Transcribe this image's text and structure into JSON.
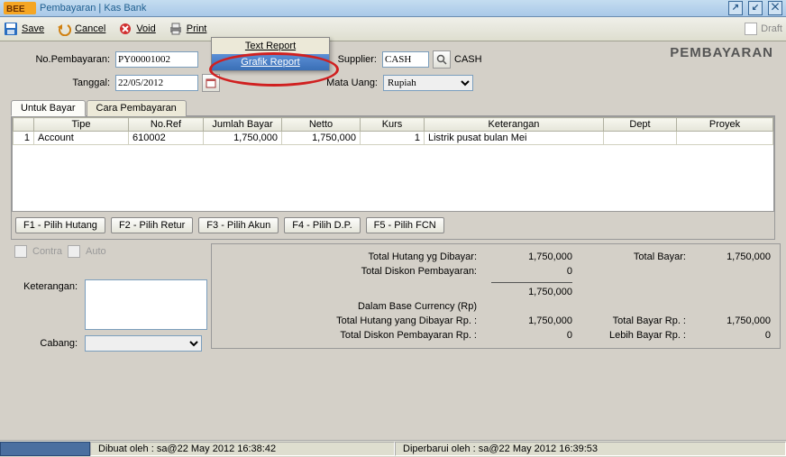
{
  "window": {
    "title": "Pembayaran | Kas Bank"
  },
  "toolbar": {
    "save": "Save",
    "cancel": "Cancel",
    "void": "Void",
    "print": "Print",
    "draft": "Draft"
  },
  "popup": {
    "text_report": "Text Report",
    "grafik_report": "Grafik Report"
  },
  "page": {
    "title": "PEMBAYARAN"
  },
  "form": {
    "labels": {
      "no_pembayaran": "No.Pembayaran:",
      "tanggal": "Tanggal:",
      "supplier": "Supplier:",
      "mata_uang": "Mata Uang:"
    },
    "no_pembayaran": "PY00001002",
    "tanggal": "22/05/2012",
    "supplier_code": "CASH",
    "supplier_name": "CASH",
    "mata_uang": "Rupiah"
  },
  "tabs": {
    "untuk_bayar": "Untuk Bayar",
    "cara_pembayaran": "Cara Pembayaran"
  },
  "grid": {
    "headers": {
      "row": "",
      "tipe": "Tipe",
      "noref": "No.Ref",
      "jumlah_bayar": "Jumlah Bayar",
      "netto": "Netto",
      "kurs": "Kurs",
      "keterangan": "Keterangan",
      "dept": "Dept",
      "proyek": "Proyek"
    },
    "rows": [
      {
        "n": "1",
        "tipe": "Account",
        "noref": "610002",
        "jumlah_bayar": "1,750,000",
        "netto": "1,750,000",
        "kurs": "1",
        "keterangan": "Listrik pusat bulan Mei",
        "dept": "",
        "proyek": ""
      }
    ]
  },
  "buttons": {
    "f1": "F1 - Pilih Hutang",
    "f2": "F2 - Pilih Retur",
    "f3": "F3 - Pilih Akun",
    "f4": "F4 - Pilih D.P.",
    "f5": "F5 - Pilih FCN"
  },
  "checks": {
    "contra": "Contra",
    "auto": "Auto"
  },
  "totals": {
    "labels": {
      "total_hutang_dibayar": "Total Hutang yg Dibayar:",
      "total_diskon_pembayaran": "Total Diskon Pembayaran:",
      "base_currency": "Dalam Base Currency (Rp)",
      "total_hutang_rp": "Total Hutang yang Dibayar Rp. :",
      "total_diskon_rp": "Total Diskon Pembayaran Rp. :",
      "total_bayar": "Total Bayar:",
      "total_bayar_rp": "Total Bayar Rp. :",
      "lebih_bayar_rp": "Lebih Bayar Rp. :"
    },
    "total_hutang_dibayar": "1,750,000",
    "total_diskon_pembayaran": "0",
    "subtotal": "1,750,000",
    "total_hutang_rp": "1,750,000",
    "total_diskon_rp": "0",
    "total_bayar": "1,750,000",
    "total_bayar_rp": "1,750,000",
    "lebih_bayar_rp": "0"
  },
  "lower": {
    "keterangan_label": "Keterangan:",
    "keterangan": "",
    "cabang_label": "Cabang:",
    "cabang": ""
  },
  "status": {
    "dibuat": "Dibuat oleh : sa@22 May 2012  16:38:42",
    "diperbarui": "Diperbarui oleh : sa@22 May 2012  16:39:53"
  }
}
